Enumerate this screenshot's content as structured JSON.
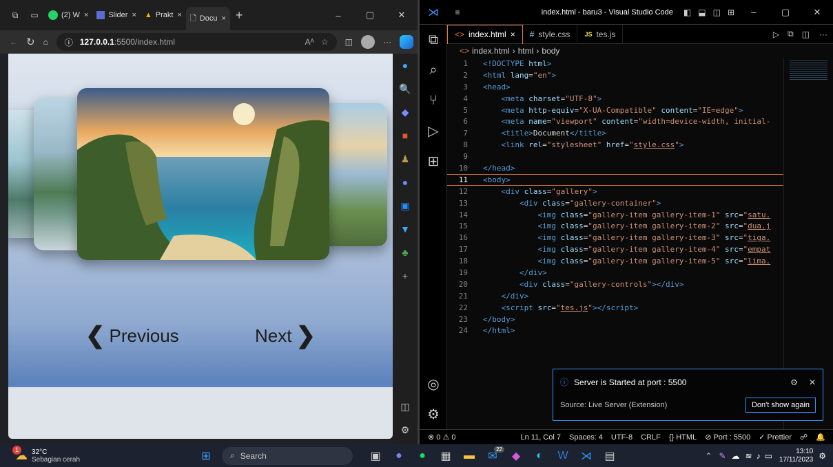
{
  "browser": {
    "tabs": [
      {
        "icon": "chat-icon",
        "label": "(2) W",
        "color": "#25d366"
      },
      {
        "icon": "list-icon",
        "label": "Slider",
        "color": "#5b6bd6"
      },
      {
        "icon": "drive-icon",
        "label": "Prakt",
        "color": "#f4b400"
      },
      {
        "icon": "page-icon",
        "label": "Docu",
        "color": "#cccccc"
      }
    ],
    "new_tab": "+",
    "url_info": "ⓘ",
    "url_host": "127.0.0.1",
    "url_rest": ":5500/index.html",
    "more": "···",
    "page": {
      "prev_label": "Previous",
      "next_label": "Next"
    }
  },
  "vscode": {
    "title": "index.html - baru3 - Visual Studio Code",
    "tabs": [
      {
        "icon": "<>",
        "label": "index.html",
        "close": "×",
        "active": true
      },
      {
        "icon": "#",
        "label": "style.css",
        "close": "",
        "active": false
      },
      {
        "icon": "JS",
        "label": "tes.js",
        "close": "",
        "active": false
      }
    ],
    "breadcrumb": [
      "index.html",
      "html",
      "body"
    ],
    "code_lines": [
      {
        "n": "1",
        "html": "<span class='tg'>&lt;!DOCTYPE</span> <span class='at'>html</span><span class='tg'>&gt;</span>"
      },
      {
        "n": "2",
        "html": "<span class='tg'>&lt;html</span> <span class='at'>lang</span>=<span class='st'>\"en\"</span><span class='tg'>&gt;</span>"
      },
      {
        "n": "3",
        "html": "<span class='tg'>&lt;head&gt;</span>"
      },
      {
        "n": "4",
        "html": "    <span class='tg'>&lt;meta</span> <span class='at'>charset</span>=<span class='st'>\"UTF-8\"</span><span class='tg'>&gt;</span>"
      },
      {
        "n": "5",
        "html": "    <span class='tg'>&lt;meta</span> <span class='at'>http-equiv</span>=<span class='st'>\"X-UA-Compatible\"</span> <span class='at'>content</span>=<span class='st'>\"IE=edge\"</span><span class='tg'>&gt;</span>"
      },
      {
        "n": "6",
        "html": "    <span class='tg'>&lt;meta</span> <span class='at'>name</span>=<span class='st'>\"viewport\"</span> <span class='at'>content</span>=<span class='st'>\"width=device-width, initial-</span>"
      },
      {
        "n": "7",
        "html": "    <span class='tg'>&lt;title&gt;</span><span class='tx'>Document</span><span class='tg'>&lt;/title&gt;</span>"
      },
      {
        "n": "8",
        "html": "    <span class='tg'>&lt;link</span> <span class='at'>rel</span>=<span class='st'>\"stylesheet\"</span> <span class='at'>href</span>=<span class='st'>\"<span class='un'>style.css</span>\"</span><span class='tg'>&gt;</span>"
      },
      {
        "n": "9",
        "html": ""
      },
      {
        "n": "10",
        "html": "<span class='tg'>&lt;/head&gt;</span>"
      },
      {
        "n": "11",
        "html": "<span class='tg'>&lt;body&gt;</span>"
      },
      {
        "n": "12",
        "html": "    <span class='tg'>&lt;div</span> <span class='at'>class</span>=<span class='st'>\"gallery\"</span><span class='tg'>&gt;</span>"
      },
      {
        "n": "13",
        "html": "        <span class='tg'>&lt;div</span> <span class='at'>class</span>=<span class='st'>\"gallery-container\"</span><span class='tg'>&gt;</span>"
      },
      {
        "n": "14",
        "html": "            <span class='tg'>&lt;img</span> <span class='at'>class</span>=<span class='st'>\"gallery-item gallery-item-1\"</span> <span class='at'>src</span>=<span class='st'>\"<span class='un'>satu.</span></span>"
      },
      {
        "n": "15",
        "html": "            <span class='tg'>&lt;img</span> <span class='at'>class</span>=<span class='st'>\"gallery-item gallery-item-2\"</span> <span class='at'>src</span>=<span class='st'>\"<span class='un'>dua.j</span></span>"
      },
      {
        "n": "16",
        "html": "            <span class='tg'>&lt;img</span> <span class='at'>class</span>=<span class='st'>\"gallery-item gallery-item-3\"</span> <span class='at'>src</span>=<span class='st'>\"<span class='un'>tiga.</span></span>"
      },
      {
        "n": "17",
        "html": "            <span class='tg'>&lt;img</span> <span class='at'>class</span>=<span class='st'>\"gallery-item gallery-item-4\"</span> <span class='at'>src</span>=<span class='st'>\"<span class='un'>empat</span></span>"
      },
      {
        "n": "18",
        "html": "            <span class='tg'>&lt;img</span> <span class='at'>class</span>=<span class='st'>\"gallery-item gallery-item-5\"</span> <span class='at'>src</span>=<span class='st'>\"<span class='un'>lima.</span></span>"
      },
      {
        "n": "19",
        "html": "        <span class='tg'>&lt;/div&gt;</span>"
      },
      {
        "n": "20",
        "html": "        <span class='tg'>&lt;div</span> <span class='at'>class</span>=<span class='st'>\"gallery-controls\"</span><span class='tg'>&gt;&lt;/div&gt;</span>"
      },
      {
        "n": "21",
        "html": "    <span class='tg'>&lt;/div&gt;</span>"
      },
      {
        "n": "22",
        "html": "    <span class='tg'>&lt;script</span> <span class='at'>src</span>=<span class='st'>\"<span class='un'>tes.js</span>\"</span><span class='tg'>&gt;&lt;/script&gt;</span>"
      },
      {
        "n": "23",
        "html": "<span class='tg'>&lt;/body&gt;</span>"
      },
      {
        "n": "24",
        "html": "<span class='tg'>&lt;/html&gt;</span>"
      }
    ],
    "current_line": "11",
    "toast": {
      "message": "Server is Started at port : 5500",
      "source": "Source: Live Server (Extension)",
      "button": "Don't show again"
    },
    "status": {
      "problems": "⊗ 0 ⚠ 0",
      "position": "Ln 11, Col 7",
      "spaces": "Spaces: 4",
      "encoding": "UTF-8",
      "eol": "CRLF",
      "language": "{} HTML",
      "port": "⊘ Port : 5500",
      "prettier": "✓ Prettier"
    }
  },
  "taskbar": {
    "weather_temp": "32°C",
    "weather_desc": "Sebagian cerah",
    "weather_badge": "1",
    "search": "Search",
    "mail_badge": "22",
    "time": "13:10",
    "date": "17/11/2023"
  },
  "colors": {
    "accent": "#e0793b",
    "vscode_blue": "#3794ff"
  }
}
